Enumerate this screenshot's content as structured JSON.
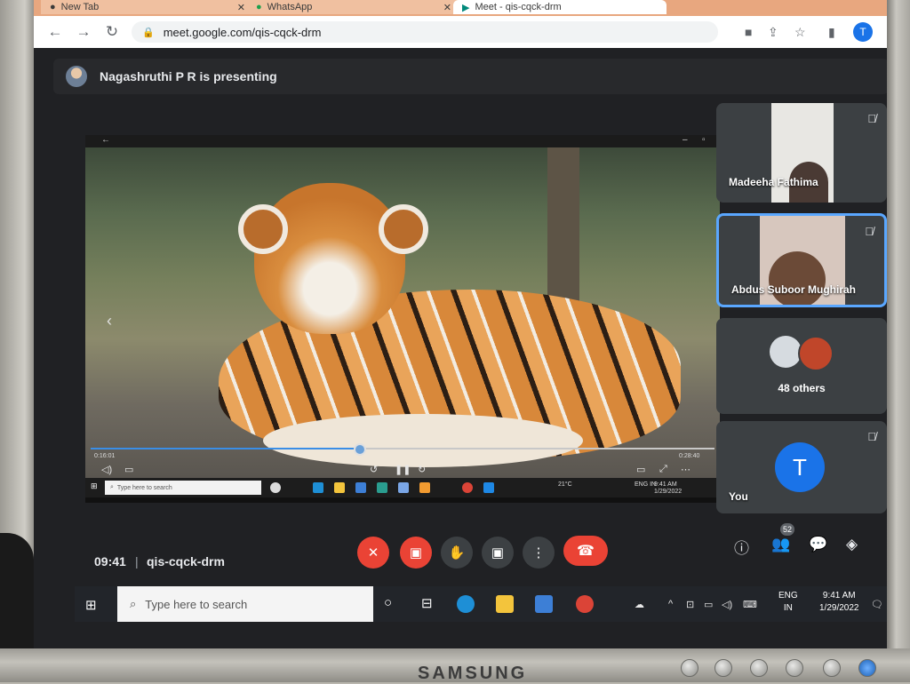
{
  "browser": {
    "tabs": [
      {
        "label": "New Tab"
      },
      {
        "label": "WhatsApp"
      },
      {
        "label": "Meet - qis-cqck-drm"
      }
    ],
    "url": "meet.google.com/qis-cqck-drm",
    "profile_initial": "T"
  },
  "presenter": {
    "text": "Nagashruthi P R is presenting"
  },
  "shared_screen": {
    "elapsed": "0:16:01",
    "duration": "0:28:40",
    "progress": 0.43,
    "taskbar_search_placeholder": "Type here to search",
    "weather": "21°C",
    "lang": "ENG IN",
    "time": "9:41 AM",
    "date": "1/29/2022"
  },
  "participants": [
    {
      "name": "Madeeha Fathima",
      "muted": true
    },
    {
      "name": "Abdus Suboor Mughirah",
      "muted": true,
      "speaking": true
    },
    {
      "others_label": "48 others"
    },
    {
      "name": "You",
      "initial": "T",
      "muted": true
    }
  ],
  "meeting": {
    "time": "09:41",
    "separator": "|",
    "code": "qis-cqck-drm",
    "people_count": "52"
  },
  "taskbar": {
    "search_placeholder": "Type here to search",
    "lang_line1": "ENG",
    "lang_line2": "IN",
    "time": "9:41 AM",
    "date": "1/29/2022"
  },
  "monitor": {
    "brand": "SAMSUNG"
  },
  "colors": {
    "accent": "#1a73e8",
    "danger": "#ea4335",
    "tile_bg": "#3c4043",
    "speaking_border": "#5aa7ff"
  }
}
